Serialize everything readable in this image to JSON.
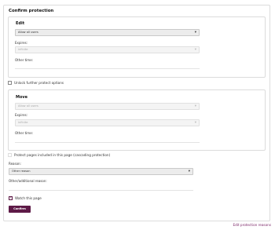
{
  "legend": "Confirm protection",
  "edit": {
    "title": "Edit",
    "level": "Allow all users",
    "expires_label": "Expires:",
    "expires_value": "infinite",
    "other_time_label": "Other time:"
  },
  "unlock": {
    "label": "Unlock further protect options"
  },
  "move": {
    "title": "Move",
    "level": "Allow all users",
    "expires_label": "Expires:",
    "expires_value": "infinite",
    "other_time_label": "Other time:"
  },
  "cascade": {
    "label": "Protect pages included in this page (cascading protection)"
  },
  "reason": {
    "label": "Reason:",
    "value": "Other reason",
    "other_label": "Other/additional reason:"
  },
  "watch": {
    "label": "Watch this page",
    "checked": true
  },
  "confirm_label": "Confirm",
  "edit_reasons_link": "Edit protection reasons"
}
